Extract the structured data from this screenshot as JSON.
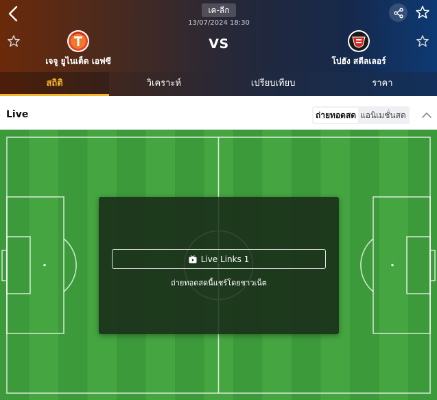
{
  "header": {
    "league": "เค-ลีก",
    "datetime": "13/07/2024 18:30",
    "vs_label": "VS",
    "home_team": {
      "name": "เจจู ยูไนเต็ด เอฟซี",
      "logo_color": "#e8442c"
    },
    "away_team": {
      "name": "โปฮัง สตีลเลอร์",
      "logo_color": "#d8261f"
    },
    "icons": {
      "back": "chevron-left-icon",
      "share": "share-icon",
      "favorite": "star-icon"
    }
  },
  "tabs": [
    {
      "label": "สถิติ",
      "active": true
    },
    {
      "label": "วิเคราะห์",
      "active": false
    },
    {
      "label": "เปรียบเทียบ",
      "active": false
    },
    {
      "label": "ราคา",
      "active": false
    }
  ],
  "live": {
    "title": "Live",
    "options": [
      {
        "label": "ถ่ายทอดสด",
        "active": true
      },
      {
        "label": "แอนิเมชั่นสด",
        "active": false
      }
    ],
    "collapse_icon": "chevron-up-icon",
    "link_label": "Live Links 1",
    "link_icon": "tv-icon",
    "note": "ถ่ายทอดสดนี้แชร์โดยชาวเน็ต"
  },
  "colors": {
    "accent": "#f6b52a",
    "pitch_light": "#44a541",
    "pitch_dark": "#3c9a3a"
  }
}
